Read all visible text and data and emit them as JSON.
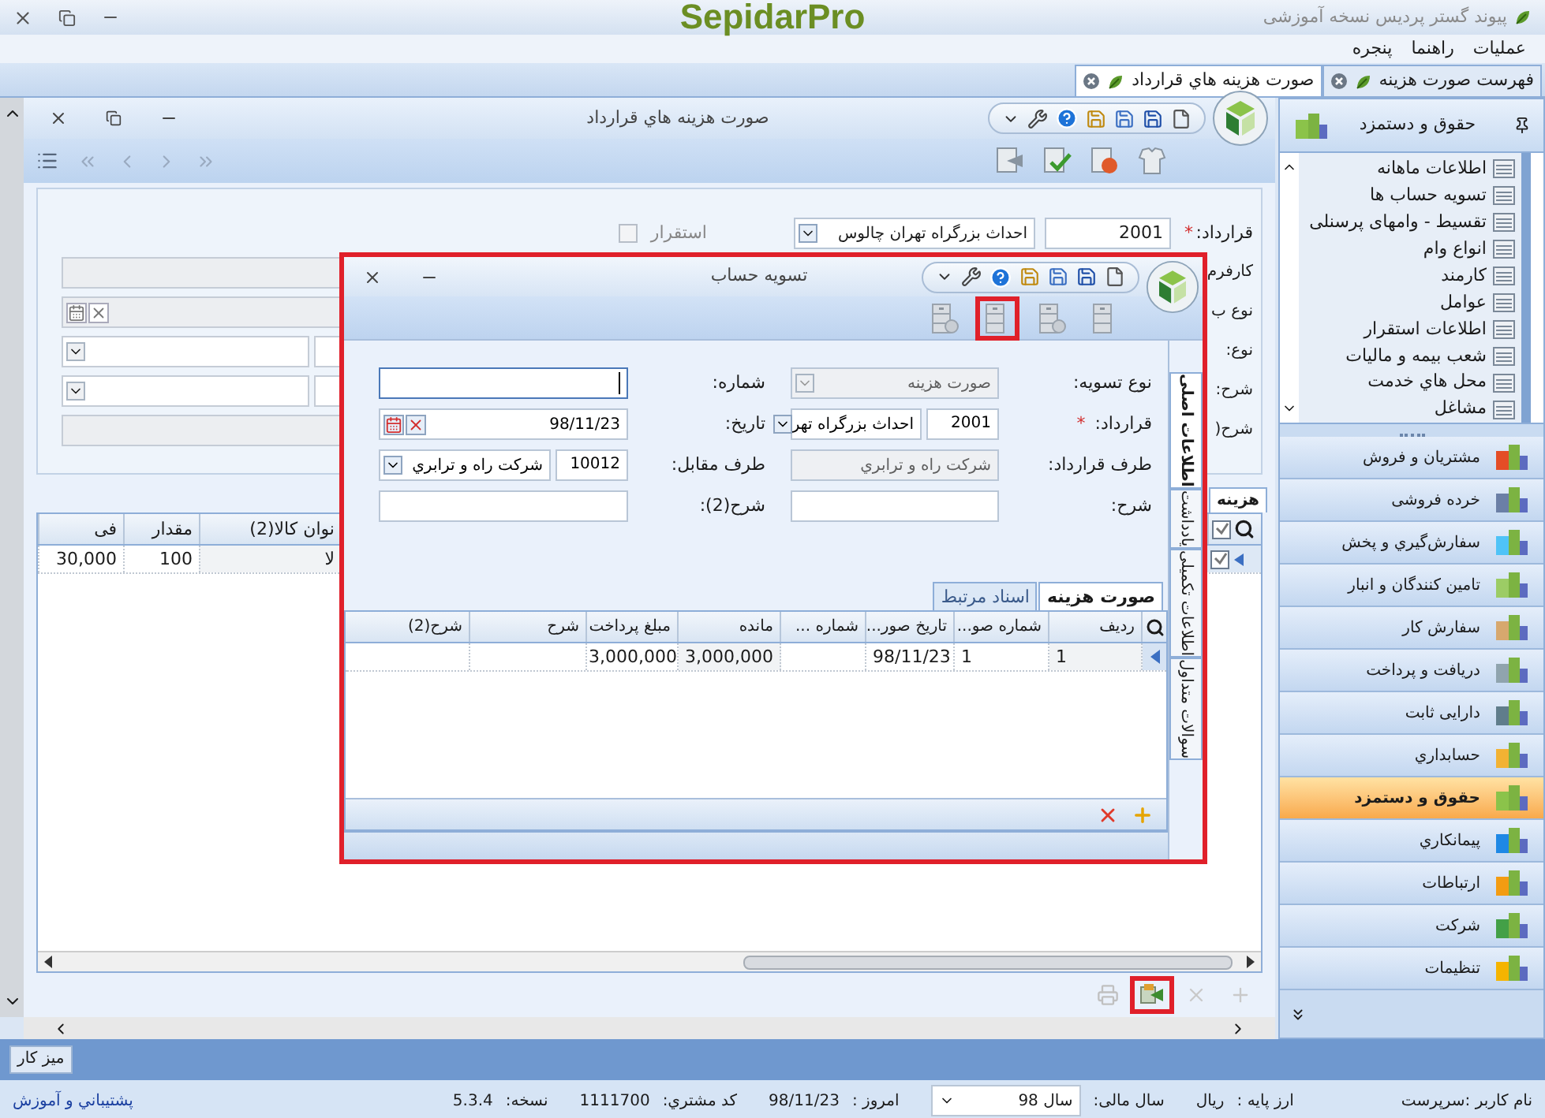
{
  "app": {
    "title": "پیوند گستر پردیس نسخه آموزشی",
    "logo": "SepidarPro"
  },
  "menu": [
    {
      "label": "عملیات"
    },
    {
      "label": "راهنما"
    },
    {
      "label": "پنجره"
    }
  ],
  "doc_tabs": [
    {
      "label": "فهرست صورت هزینه",
      "selected": false
    },
    {
      "label": "صورت هزینه هاي قرارداد",
      "selected": true
    }
  ],
  "document": {
    "title": "صورت هزينه هاي قرارداد",
    "contract": {
      "label": "قرارداد:",
      "required_mark": "*",
      "code": "2001",
      "value": "احداث بزرگراه تهران چالوس"
    },
    "settle": {
      "label": "استقرار",
      "checked": false
    },
    "side_labels": [
      "کارفرم",
      "نوع ب",
      "نوع:",
      "شرح:",
      "شرح("
    ],
    "left_fields": [
      {
        "kind": "readonly"
      },
      {
        "kind": "date"
      },
      {
        "kind": "combo"
      },
      {
        "kind": "combo"
      },
      {
        "kind": "readonly"
      }
    ],
    "grid_tab": "هزینه",
    "grid": {
      "header_checked": true,
      "columns": [
        "نوان کالا(2)",
        "مقدار",
        "فی"
      ],
      "rows": [
        {
          "checked": true,
          "cells": [
            "لا",
            "100",
            "30,000"
          ]
        }
      ]
    },
    "footer_tools": [
      {
        "kind": "add",
        "highlighted": false
      },
      {
        "kind": "delete",
        "highlighted": false
      },
      {
        "kind": "link",
        "highlighted": true
      },
      {
        "kind": "print",
        "highlighted": false
      }
    ]
  },
  "dialog": {
    "title": "تسویه حساب",
    "highlighted": true,
    "ribbon": [
      {
        "kind": "cabinet",
        "highlighted": false
      },
      {
        "kind": "cabinet-star",
        "highlighted": false
      },
      {
        "kind": "cabinet",
        "highlighted": true
      },
      {
        "kind": "cabinet-star",
        "highlighted": false
      }
    ],
    "side_tabs": [
      {
        "label": "اطلاعات اصلی",
        "selected": true
      },
      {
        "label": "یادداشت",
        "selected": false
      },
      {
        "label": "اطلاعات تکمیلی",
        "selected": false
      },
      {
        "label": "سوالات متداول",
        "selected": false
      }
    ],
    "fields_right": [
      {
        "label": "نوع تسویه:",
        "kind": "combo",
        "value": "صورت هزینه",
        "disabled": true
      },
      {
        "label": "قرارداد:",
        "required_mark": "*",
        "kind": "combo",
        "code": "2001",
        "value": "احداث بزرگراه تهر",
        "disabled": false
      },
      {
        "label": "طرف قرارداد:",
        "kind": "text",
        "value": "شرکت راه و ترابري",
        "disabled": true
      },
      {
        "label": "شرح:",
        "kind": "text",
        "disabled": false
      }
    ],
    "fields_left": [
      {
        "label": "شماره:",
        "kind": "text",
        "disabled": false,
        "focused": true
      },
      {
        "label": "تاریخ:",
        "kind": "date",
        "value": "98/11/23",
        "disabled": false,
        "focused": false
      },
      {
        "label": "طرف مقابل:",
        "kind": "combo",
        "code": "10012",
        "value": "شرکت راه و ترابري",
        "disabled": false,
        "focused": false
      },
      {
        "label": "شرح(2):",
        "kind": "text",
        "disabled": false,
        "focused": false
      }
    ],
    "sub_tabs": [
      {
        "label": "صورت هزينه",
        "selected": true
      },
      {
        "label": "اسناد مرتبط",
        "selected": false
      }
    ],
    "grid": {
      "columns": [
        "ردیف",
        "شماره صو...",
        "تاریخ صور...",
        "شماره ...",
        "مانده",
        "مبلغ پرداخت",
        "شرح",
        "شرح(2)"
      ],
      "rows": [
        {
          "selected": true,
          "cells": [
            "1",
            "1",
            "98/11/23",
            null,
            "3,000,000",
            "3,000,000",
            null,
            null
          ]
        }
      ]
    }
  },
  "sidebar": {
    "title": "حقوق و دستمزد",
    "tree": [
      "اطلاعات ماهانه",
      "تسویه حساب ها",
      "تقسیط - وامهای پرسنلی",
      "انواع وام",
      "کارمند",
      "عوامل",
      "اطلاعات استقرار",
      "شعب بیمه و مالیات",
      "محل هاي خدمت",
      "مشاغل"
    ],
    "modules": [
      {
        "label": "مشتریان و فروش",
        "selected": false
      },
      {
        "label": "خرده فروشی",
        "selected": false
      },
      {
        "label": "سفارش‌گیري و پخش",
        "selected": false
      },
      {
        "label": "تامین کنندگان و انبار",
        "selected": false
      },
      {
        "label": "سفارش کار",
        "selected": false
      },
      {
        "label": "دریافت و پرداخت",
        "selected": false
      },
      {
        "label": "دارایی ثابت",
        "selected": false
      },
      {
        "label": "حسابداري",
        "selected": false
      },
      {
        "label": "حقوق و دستمزد",
        "selected": true
      },
      {
        "label": "پیمانکاري",
        "selected": false
      },
      {
        "label": "ارتباطات",
        "selected": false
      },
      {
        "label": "شرکت",
        "selected": false
      },
      {
        "label": "تنظیمات",
        "selected": false
      }
    ]
  },
  "taskbar": [
    {
      "label": "میز کار"
    }
  ],
  "status": {
    "user": "نام کاربر :سرپرست",
    "currency_label": "ارز پایه :",
    "currency": "ریال",
    "year_label": "سال مالی:",
    "year": "سال 98",
    "today_label": "امروز :",
    "today": "98/11/23",
    "customer_label": "کد مشتري:",
    "customer": "1111700",
    "version_label": "نسخه:",
    "version": "5.3.4",
    "support": "پشتیباني و آموزش"
  }
}
